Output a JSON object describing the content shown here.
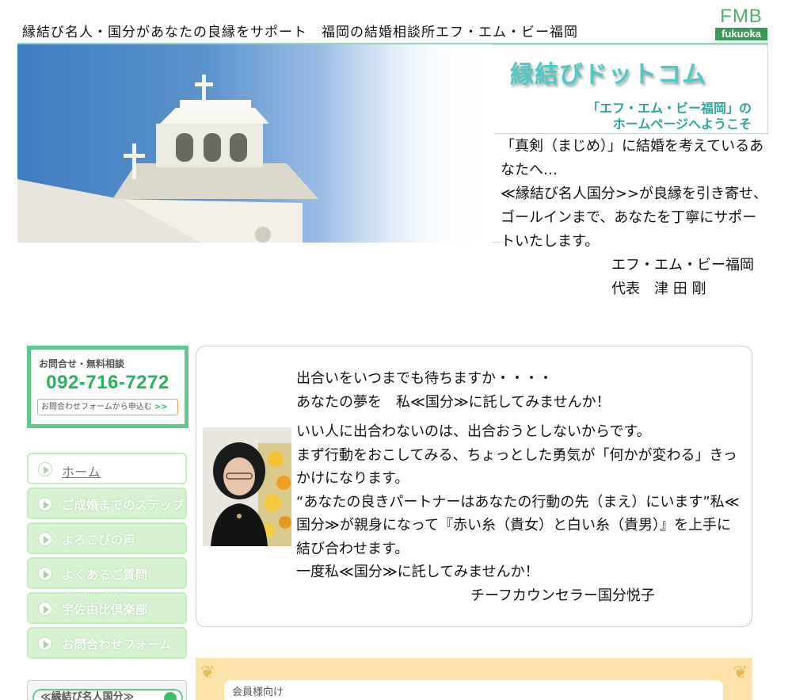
{
  "header": {
    "site_title": "縁結び名人・国分があなたの良縁をサポート　福岡の結婚相談所エフ・エム・ビー福岡",
    "logo_main": "FMB",
    "logo_sub": "fukuoka"
  },
  "banner": {
    "brand": "縁結びドットコム",
    "welcome_line1": "「エフ・エム・ビー福岡」の",
    "welcome_line2": "ホームページへようこそ"
  },
  "intro": {
    "line1": "「真剣（まじめ）」に結婚を考えているあなたへ…",
    "line2": "≪縁結び名人国分>>が良縁を引き寄せ、ゴールインまで、あなたを丁寧にサポートいたします。",
    "signature": "エフ・エム・ビー福岡　代表　津 田 剛"
  },
  "contact": {
    "title": "お問合せ・無料相談",
    "phone": "092-716-7272",
    "form_button": "お問合わせフォームから申込む",
    "form_button_arrow": ">>"
  },
  "nav": {
    "items": [
      {
        "label": "ホーム"
      },
      {
        "label": "ご成婚までのステップ"
      },
      {
        "label": "よろこびの声"
      },
      {
        "label": "よくあるご質問"
      },
      {
        "label": "宇佐由比倶楽部",
        "ruby": "うさゆいくらぶ"
      },
      {
        "label": "お問合わせフォーム"
      }
    ],
    "bottom_label": "≪縁結び名人国分≫"
  },
  "message": {
    "line1": "出合いをいつまでも待ちますか・・・・",
    "line2": "あなたの夢を　私≪国分≫に託してみませんか！",
    "body1": "いい人に出合わないのは、出合おうとしないからです。",
    "body2": "まず行動をおこしてみる、ちょっとした勇気が「何かが変わる」きっかけになります。",
    "body3": "“あなたの良きパートナーはあなたの行動の先（まえ）にいます”私≪国分≫が親身になって『赤い糸（貴女）と白い糸（貴男）』を上手に結び合わせます。",
    "body4": "一度私≪国分≫に託してみませんか！",
    "signature": "チーフカウンセラー国分悦子"
  },
  "members": {
    "label": "会員様向け"
  }
}
